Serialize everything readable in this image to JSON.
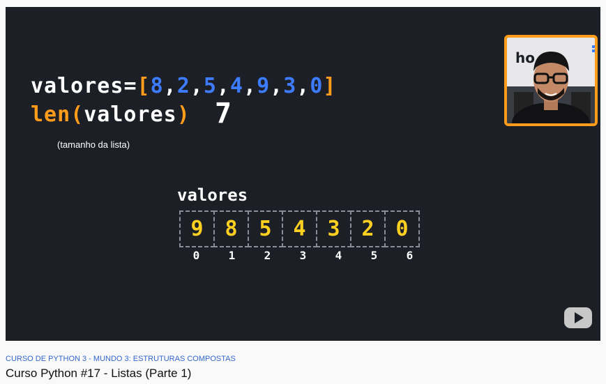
{
  "video": {
    "line1": {
      "var": "valores",
      "eq": "=",
      "open": "[",
      "items": [
        "8",
        "2",
        "5",
        "4",
        "9",
        "3",
        "0"
      ],
      "sep": ",",
      "close": "]"
    },
    "line2": {
      "func": "len",
      "open": "(",
      "arg": "valores",
      "close": ")",
      "result": "7"
    },
    "note": "(tamanho da lista)",
    "array": {
      "title": "valores",
      "cells": [
        "9",
        "8",
        "5",
        "4",
        "3",
        "2",
        "0"
      ],
      "indices": [
        "0",
        "1",
        "2",
        "3",
        "4",
        "5",
        "6"
      ]
    },
    "webcam_logo": "ho",
    "play_icon": "play-icon"
  },
  "meta": {
    "series": "CURSO DE PYTHON 3 - MUNDO 3: ESTRUTURAS COMPOSTAS",
    "title": "Curso Python #17 - Listas (Parte 1)"
  },
  "colors": {
    "background": "#1d1f27",
    "orange": "#ff9c1a",
    "blue": "#3d7cff",
    "yellow": "#ffd020",
    "link": "#3366cc"
  }
}
